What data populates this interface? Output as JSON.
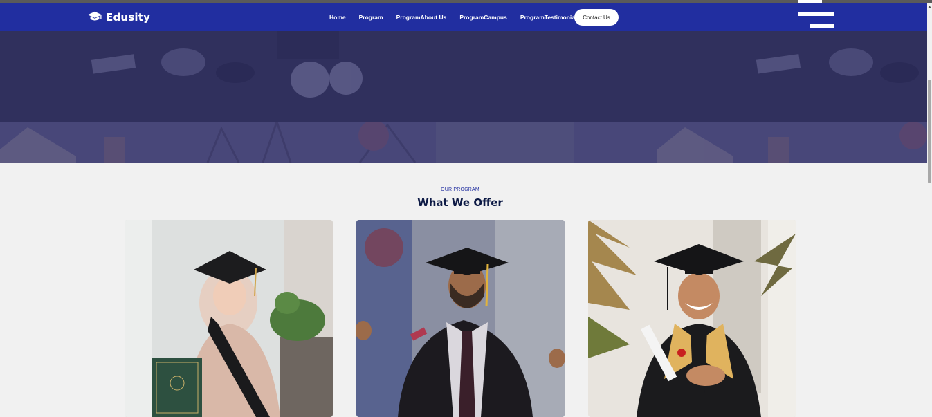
{
  "brand": {
    "name": "Edusity",
    "icon": "graduation-cap-icon"
  },
  "nav": {
    "links": [
      "Home",
      "Program",
      "ProgramAbout Us",
      "ProgramCampus",
      "ProgramTestimonials"
    ],
    "contact_label": "Contact Us",
    "menu_icon": "hamburger-menu-icon"
  },
  "colors": {
    "navbar": "#212ea0",
    "title": "#0d1a45",
    "background": "#f1f1f1"
  },
  "programs": {
    "subtitle": "OUR PROGRAM",
    "title": "What We Offer",
    "cards": [
      {
        "image": "graduate-woman-hijab-photo"
      },
      {
        "image": "graduate-man-tie-photo"
      },
      {
        "image": "graduate-man-diploma-photo"
      }
    ]
  }
}
